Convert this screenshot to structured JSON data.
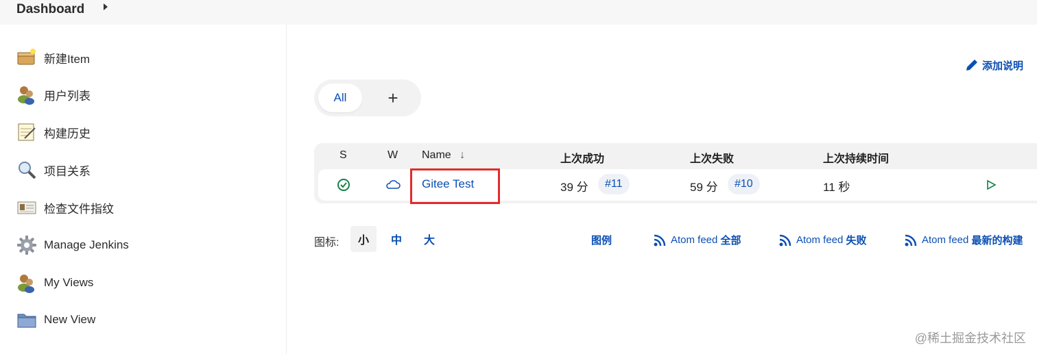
{
  "breadcrumb": {
    "root": "Dashboard"
  },
  "sidebar": {
    "items": [
      {
        "label": "新建Item",
        "icon": "new-item-icon"
      },
      {
        "label": "用户列表",
        "icon": "users-icon"
      },
      {
        "label": "构建历史",
        "icon": "notepad-icon"
      },
      {
        "label": "项目关系",
        "icon": "search-icon"
      },
      {
        "label": "检查文件指纹",
        "icon": "fingerprint-card-icon"
      },
      {
        "label": "Manage Jenkins",
        "icon": "gear-icon"
      },
      {
        "label": "My Views",
        "icon": "users-icon"
      },
      {
        "label": "New View",
        "icon": "folder-icon"
      }
    ]
  },
  "main": {
    "add_description": "添加说明",
    "tabs": {
      "all": "All",
      "add": "+"
    },
    "table": {
      "headers": {
        "s": "S",
        "w": "W",
        "name": "Name",
        "name_sort": "↓",
        "last_success": "上次成功",
        "last_failure": "上次失败",
        "last_duration": "上次持续时间"
      },
      "rows": [
        {
          "name": "Gitee Test",
          "last_success": "39 分",
          "last_success_build": "#11",
          "last_failure": "59 分",
          "last_failure_build": "#10",
          "duration": "11 秒"
        }
      ]
    },
    "footer": {
      "icon_label": "图标:",
      "sizes": [
        "小",
        "中",
        "大"
      ],
      "legend": "图例",
      "feed_prefix": "Atom feed",
      "feed_all": "全部",
      "feed_failed": "失败",
      "feed_latest": "最新的构建"
    }
  },
  "watermark": "@稀土掘金技术社区",
  "colors": {
    "link": "#0b4fb3",
    "success": "#138347",
    "highlight": "#e32a2a"
  }
}
